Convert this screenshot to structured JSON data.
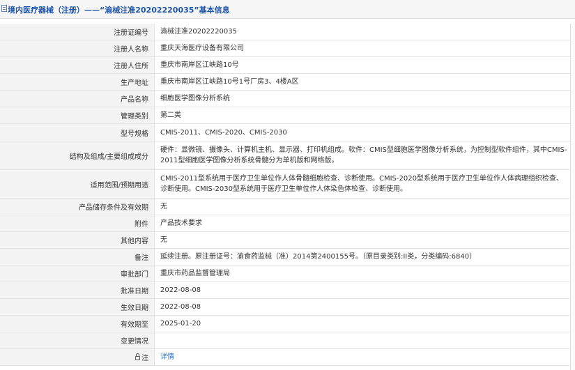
{
  "header": {
    "title": "境内医疗器械（注册）——“渝械注准20202220035”基本信息"
  },
  "rows": [
    {
      "label": "注册证编号",
      "value": "渝械注准20202220035"
    },
    {
      "label": "注册人名称",
      "value": "重庆天海医疗设备有限公司"
    },
    {
      "label": "注册人住所",
      "value": "重庆市南岸区江峡路10号"
    },
    {
      "label": "生产地址",
      "value": "重庆市南岸区江峡路10号1号厂房3、4楼A区"
    },
    {
      "label": "产品名称",
      "value": "细胞医学图像分析系统"
    },
    {
      "label": "管理类别",
      "value": "第二类"
    },
    {
      "label": "型号规格",
      "value": "CMIS-2011、CMIS-2020、CMIS-2030"
    },
    {
      "label": "结构及组成/主要组成成分",
      "value": "硬件：显微镜、摄像头、计算机主机、显示器、打印机组成。软件：CMIS型细胞医学图像分析系统，为控制型软件组件，其中CMIS-2011型细胞医学图像分析系统骨髓分为单机版和网络版。"
    },
    {
      "label": "适用范围/预期用途",
      "value": "CMIS-2011型系统用于医疗卫生单位作人体骨髓细胞检查、诊断使用。CMIS-2020型系统用于医疗卫生单位作人体病理组织检查、诊断使用。CMIS-2030型系统用于医疗卫生单位作人体染色体检查、诊断使用。"
    },
    {
      "label": "产品储存条件及有效期",
      "value": "无"
    },
    {
      "label": "附件",
      "value": "产品技术要求"
    },
    {
      "label": "其他内容",
      "value": "无"
    },
    {
      "label": "备注",
      "value": "延续注册。原注册证号：渝食药监械（准）2014第2400155号。（原目录类别:II类，分类编码:6840）"
    },
    {
      "label": "审批部门",
      "value": "重庆市药品监督管理局"
    },
    {
      "label": "批准日期",
      "value": "2022-08-08"
    },
    {
      "label": "生效日期",
      "value": "2022-08-08"
    },
    {
      "label": "有效期至",
      "value": "2025-01-20"
    },
    {
      "label": "变更情况",
      "value": ""
    },
    {
      "label": "注",
      "value": "详情",
      "icon": "lock-icon",
      "link": true
    }
  ],
  "colors": {
    "title": "#1f55a7",
    "label_bg": "#f3f3f3",
    "border": "#e3e3e3",
    "link": "#2a6ebb"
  }
}
